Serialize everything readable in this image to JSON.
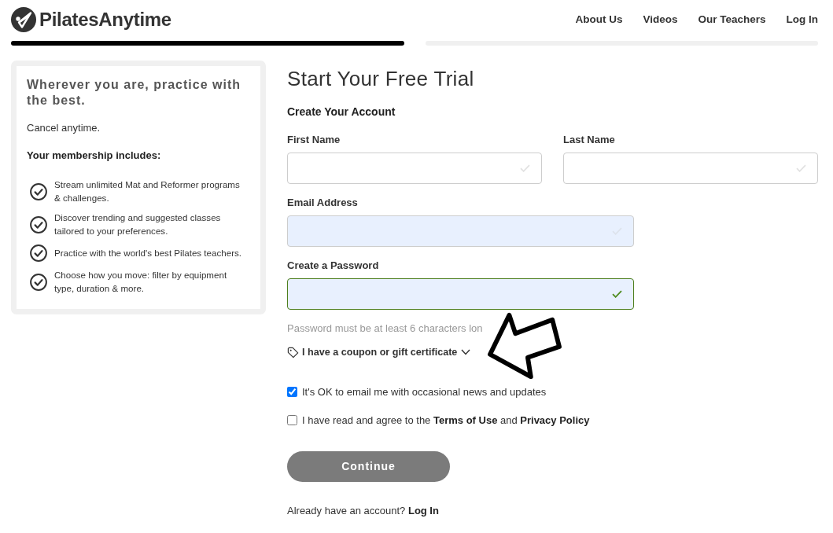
{
  "header": {
    "logo": {
      "text": "PilatesAnytime"
    },
    "nav": [
      {
        "label": "About Us"
      },
      {
        "label": "Videos"
      },
      {
        "label": "Our Teachers"
      },
      {
        "label": "Log In"
      }
    ]
  },
  "steps": [
    {
      "done": true
    },
    {
      "done": false
    }
  ],
  "sidebar": {
    "heading": "Wherever you are, practice with the best.",
    "note": "Cancel anytime.",
    "includes_title": "Your membership includes:",
    "items": [
      "Stream unlimited Mat and Reformer programs & challenges.",
      "Discover trending and suggested classes tailored to your preferences.",
      "Practice with the world's best Pilates teachers.",
      "Choose how you move: filter by equipment type, duration & more."
    ]
  },
  "form": {
    "title": "Start Your Free Trial",
    "subtitle": "Create Your Account",
    "rows": [
      {
        "fields": [
          {
            "label": "First Name",
            "valid": false,
            "autofilled": false
          },
          {
            "label": "Last Name",
            "valid": false,
            "autofilled": false
          }
        ]
      },
      {
        "fields": [
          {
            "label": "Email Address",
            "valid": false,
            "autofilled": true
          }
        ]
      },
      {
        "fields": [
          {
            "label": "Create a Password",
            "valid": true,
            "autofilled": true
          }
        ]
      }
    ],
    "hint": "Password must be at least 6 characters lon",
    "coupon": {
      "label": "I have a coupon or gift certificate",
      "expanded": false
    },
    "checkboxes": [
      {
        "checked": true,
        "parts": [
          {
            "text": "It's OK to email me with occasional news and updates"
          }
        ]
      },
      {
        "checked": false,
        "parts": [
          {
            "text": "I have read and agree to the "
          },
          {
            "text": "Terms of Use",
            "kind": "link"
          },
          {
            "text": " and "
          },
          {
            "text": "Privacy Policy",
            "kind": "link"
          }
        ]
      }
    ],
    "button": {
      "label": "Continue",
      "disabled": true
    },
    "login_prompt": {
      "parts": [
        {
          "text": "Already have an account? "
        },
        {
          "text": "Log In",
          "kind": "link"
        }
      ]
    }
  },
  "annotations": [
    {
      "kind": "arrow"
    }
  ]
}
